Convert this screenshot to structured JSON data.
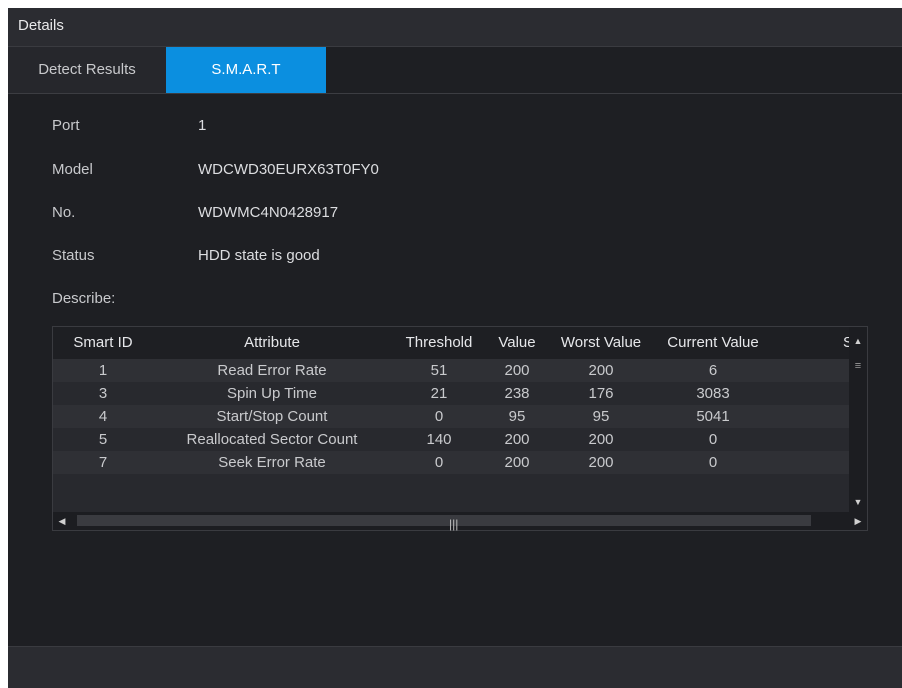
{
  "window": {
    "title": "Details"
  },
  "tabs": [
    {
      "label": "Detect Results",
      "active": false
    },
    {
      "label": "S.M.A.R.T",
      "active": true
    }
  ],
  "fields": {
    "port": {
      "label": "Port",
      "value": "1"
    },
    "model": {
      "label": "Model",
      "value": "WDCWD30EURX63T0FY0"
    },
    "number": {
      "label": "No.",
      "value": "WDWMC4N0428917"
    },
    "status": {
      "label": "Status",
      "value": "HDD state is good"
    },
    "describe": {
      "label": "Describe:"
    }
  },
  "table": {
    "headers": [
      "Smart ID",
      "Attribute",
      "Threshold",
      "Value",
      "Worst Value",
      "Current Value",
      "S"
    ],
    "rows": [
      [
        "1",
        "Read Error Rate",
        "51",
        "200",
        "200",
        "6"
      ],
      [
        "3",
        "Spin Up Time",
        "21",
        "238",
        "176",
        "3083"
      ],
      [
        "4",
        "Start/Stop Count",
        "0",
        "95",
        "95",
        "5041"
      ],
      [
        "5",
        "Reallocated Sector Count",
        "140",
        "200",
        "200",
        "0"
      ],
      [
        "7",
        "Seek Error Rate",
        "0",
        "200",
        "200",
        "0"
      ]
    ]
  },
  "icons": {
    "scroll_up": "triangle-up",
    "scroll_down": "triangle-down",
    "scroll_left": "triangle-left",
    "scroll_right": "triangle-right",
    "grip": "grip-lines"
  },
  "colors": {
    "accent": "#0b8fe0",
    "background": "#1e1f23"
  }
}
